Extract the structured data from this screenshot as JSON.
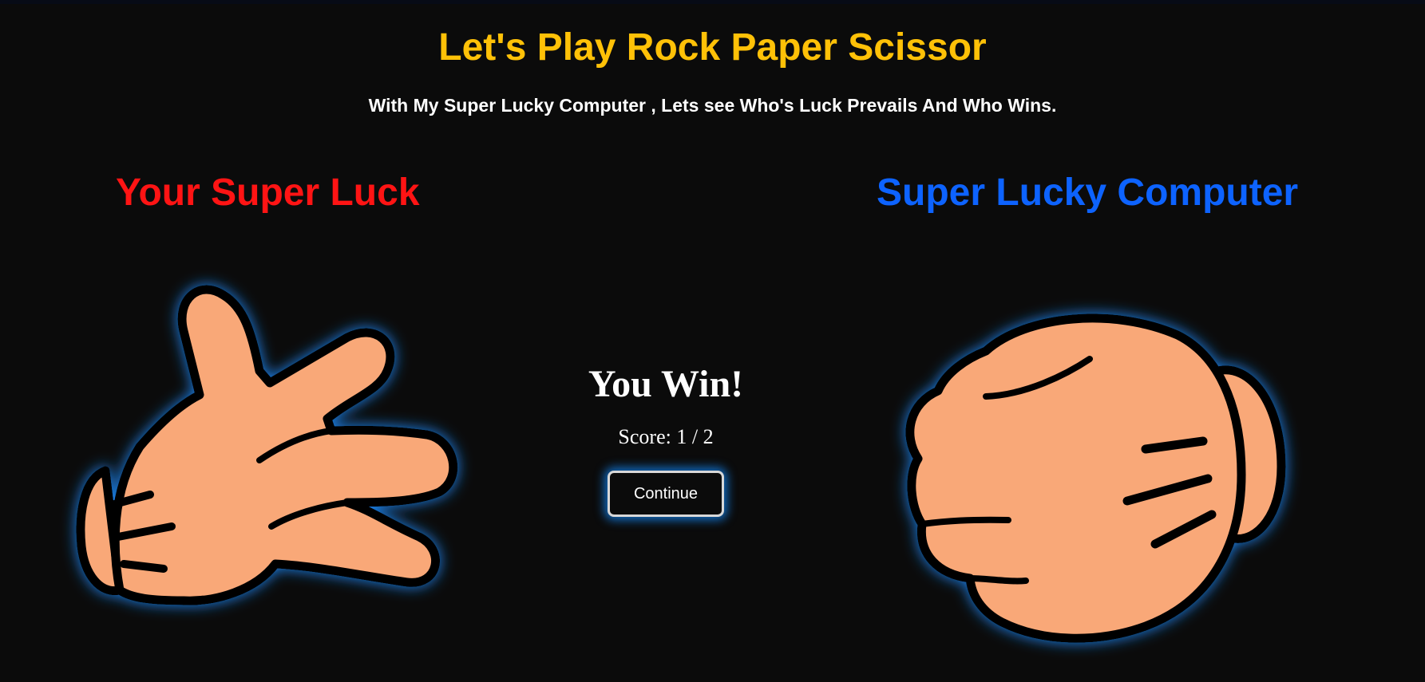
{
  "header": {
    "title": "Let's Play Rock Paper Scissor",
    "subtitle": "With My Super Lucky Computer , Lets see Who's Luck Prevails And Who Wins."
  },
  "players": {
    "you": {
      "heading": "Your Super Luck",
      "choice": "scissor-hand-icon",
      "color": "#ff1414"
    },
    "computer": {
      "heading": "Super Lucky Computer",
      "choice": "rock-fist-icon",
      "color": "#0d63ff"
    }
  },
  "result": {
    "message": "You Win!",
    "score_label": "Score:",
    "score": 1,
    "total": 2,
    "score_text": "Score: 1 / 2",
    "continue_label": "Continue"
  },
  "colors": {
    "background": "#0b0b0b",
    "title": "#ffc107",
    "skin": "#f9a878",
    "outline": "#000000",
    "glow": "#1e8cff"
  }
}
